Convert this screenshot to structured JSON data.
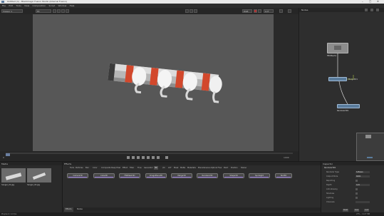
{
  "window": {
    "title": "Untitled (1) - Blackmagic Fusion Studio (Internal Fusion)"
  },
  "menubar": [
    "File",
    "Edit",
    "Tools",
    "View",
    "Composition",
    "Script",
    "Window",
    "Help"
  ],
  "viewer_toolbar": {
    "viewer_select": "Viewer 1",
    "zoom": "Fit",
    "channel": "RGB",
    "lut": "LUT"
  },
  "viewer_controls": {
    "frame": "0",
    "end_frame": "1000"
  },
  "node_panel": {
    "title": "Nodes",
    "nodes": [
      {
        "name": "FBXMesh1",
        "type": "3d"
      },
      {
        "name": "Merge3D1",
        "type": "merge"
      },
      {
        "name": "Renderer3D1",
        "type": "render"
      }
    ]
  },
  "media_pool": {
    "title": "Media",
    "items": [
      {
        "label": "hanger_01.jpg"
      },
      {
        "label": "hanger_02.jpg"
      }
    ]
  },
  "effects": {
    "title": "Effects",
    "tabs": [
      "Tools",
      "Particles",
      "3D",
      "Blur",
      "Color",
      "Composite",
      "Deep Pixel",
      "Effect",
      "Filter",
      "Flow",
      "Generator",
      "I/O",
      "LUT",
      "Mask",
      "Matte",
      "Metadata",
      "Miscellaneous",
      "Optical Flow",
      "Paint",
      "Position",
      "Stereo"
    ],
    "active_tab": "3D",
    "buttons": [
      "Camera3D",
      "Cube3D",
      "FBXMesh3D",
      "ImagePlane3D",
      "Merge3D",
      "Renderer3D",
      "Shape3D",
      "SpotLight",
      "Text3D"
    ],
    "bottom_tabs": [
      "Effects",
      "Nodes"
    ]
  },
  "inspector": {
    "title": "Inspector",
    "rows": [
      {
        "label": "Renderer3D1",
        "value": ""
      },
      {
        "label": "Renderer Type",
        "value": "Software"
      },
      {
        "label": "Output Mode",
        "value": "RGBA"
      },
      {
        "label": "Reporting",
        "value": ""
      },
      {
        "label": "Depth",
        "value": "Auto"
      },
      {
        "label": "Anti-Aliasing",
        "value": ""
      },
      {
        "label": "Shadows",
        "value": ""
      },
      {
        "label": "Lighting",
        "value": ""
      },
      {
        "label": "Channels",
        "value": ""
      }
    ],
    "buttons": [
      "Reset",
      "Save",
      "Load"
    ]
  },
  "statusbar": {
    "left": "Playback: 0.0 fps",
    "right": "27% - 1127 MB"
  },
  "colors": {
    "accent": "#8d6fd3",
    "node_3d": "#5a7c9c",
    "viewer_bg": "#575757"
  }
}
